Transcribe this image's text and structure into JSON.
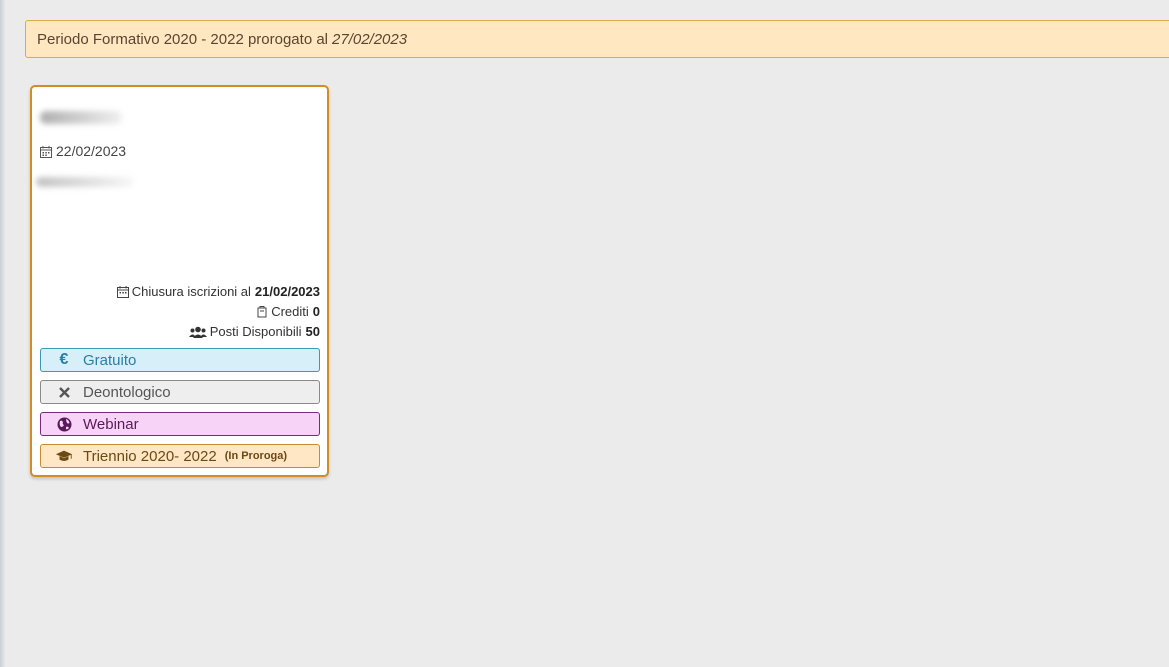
{
  "notice": {
    "text": "Periodo Formativo 2020 - 2022 prorogato al",
    "date": "27/02/2023"
  },
  "card": {
    "date": "22/02/2023",
    "closing_label": "Chiusura iscrizioni al",
    "closing_date": "21/02/2023",
    "credits_label": "Crediti",
    "credits_value": "0",
    "seats_label": "Posti Disponibili",
    "seats_value": "50",
    "tags": {
      "free": "Gratuito",
      "deontology": "Deontologico",
      "webinar": "Webinar",
      "triennium": "Triennio 2020- 2022",
      "triennium_note": "(In Proroga)"
    },
    "icons": {
      "date": "calendar-icon",
      "closing": "calendar-icon",
      "credits": "certificate-icon",
      "seats": "users-icon",
      "free": "euro-icon",
      "deontology": "close-icon",
      "webinar": "globe-icon",
      "triennium": "graduation-cap-icon"
    }
  },
  "colors": {
    "notice_bg": "#ffe7c2",
    "card_border": "#d28e22",
    "free": "#2a7ea4",
    "webinar": "#5a1a5a",
    "triennium": "#6b4a16"
  }
}
